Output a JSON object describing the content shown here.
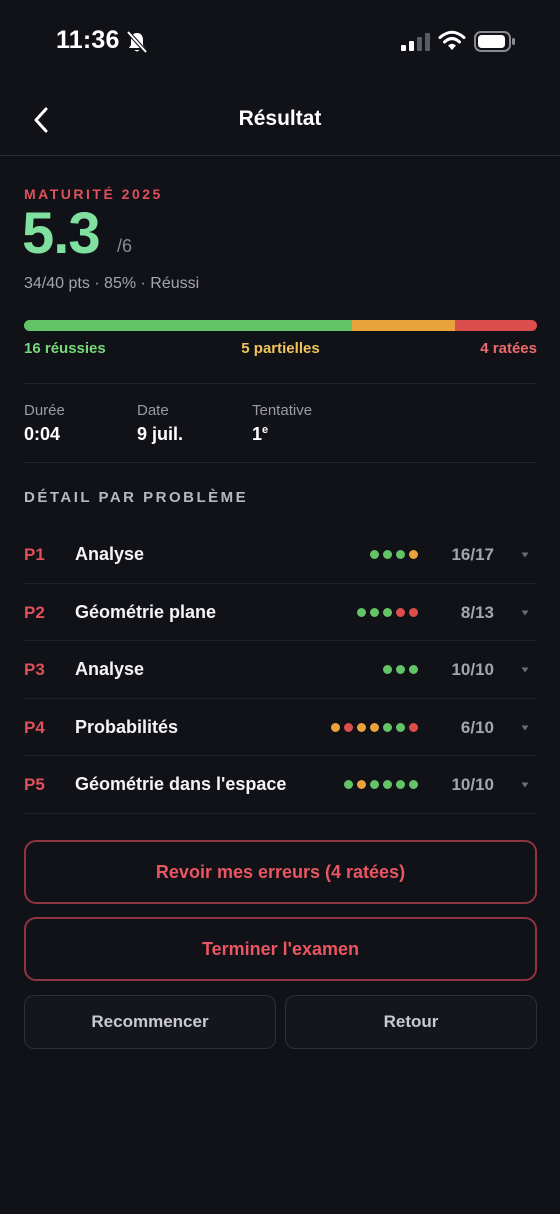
{
  "status_bar": {
    "time": "11:36",
    "icons": [
      "bell-slash-icon",
      "cellular-signal-icon",
      "wifi-icon",
      "battery-icon"
    ]
  },
  "nav": {
    "title": "Résultat",
    "back_icon": "chevron-left-icon"
  },
  "result": {
    "exam_label": "MATURITÉ 2025",
    "score": "5.3",
    "score_max": "/6",
    "summary": "34/40 pts · 85%  ·  Réussi",
    "breakdown": {
      "success_count": 16,
      "partial_count": 5,
      "failed_count": 4,
      "success_label": "16 réussies",
      "partial_label": "5 partielles",
      "failed_label": "4 ratées"
    },
    "stats": [
      {
        "label": "Durée",
        "value": "0:04"
      },
      {
        "label": "Date",
        "value": "9 juil."
      },
      {
        "label": "Tentative",
        "value": "1",
        "suffix": "e"
      }
    ]
  },
  "problems_section": {
    "title": "DÉTAIL PAR PROBLÈME",
    "items": [
      {
        "code": "P1",
        "name": "Analyse",
        "score": "16/17",
        "dots": [
          "green",
          "green",
          "green",
          "orange"
        ]
      },
      {
        "code": "P2",
        "name": "Géométrie plane",
        "score": "8/13",
        "dots": [
          "green",
          "green",
          "green",
          "red",
          "red"
        ]
      },
      {
        "code": "P3",
        "name": "Analyse",
        "score": "10/10",
        "dots": [
          "green",
          "green",
          "green"
        ]
      },
      {
        "code": "P4",
        "name": "Probabilités",
        "score": "6/10",
        "dots": [
          "orange",
          "red",
          "orange",
          "orange",
          "green",
          "green",
          "red"
        ]
      },
      {
        "code": "P5",
        "name": "Géométrie dans l'espace",
        "score": "10/10",
        "dots": [
          "green",
          "orange",
          "green",
          "green",
          "green",
          "green"
        ]
      }
    ]
  },
  "actions": {
    "review_label": "Revoir mes erreurs (4 ratées)",
    "finish_label": "Terminer l'examen",
    "restart_label": "Recommencer",
    "back_label": "Retour"
  },
  "colors": {
    "background": "#111217",
    "accent_red": "#e0505a",
    "score_green": "#7fe0a0",
    "green": "#62c466",
    "orange": "#e8a33d",
    "red": "#dc4e4e"
  }
}
